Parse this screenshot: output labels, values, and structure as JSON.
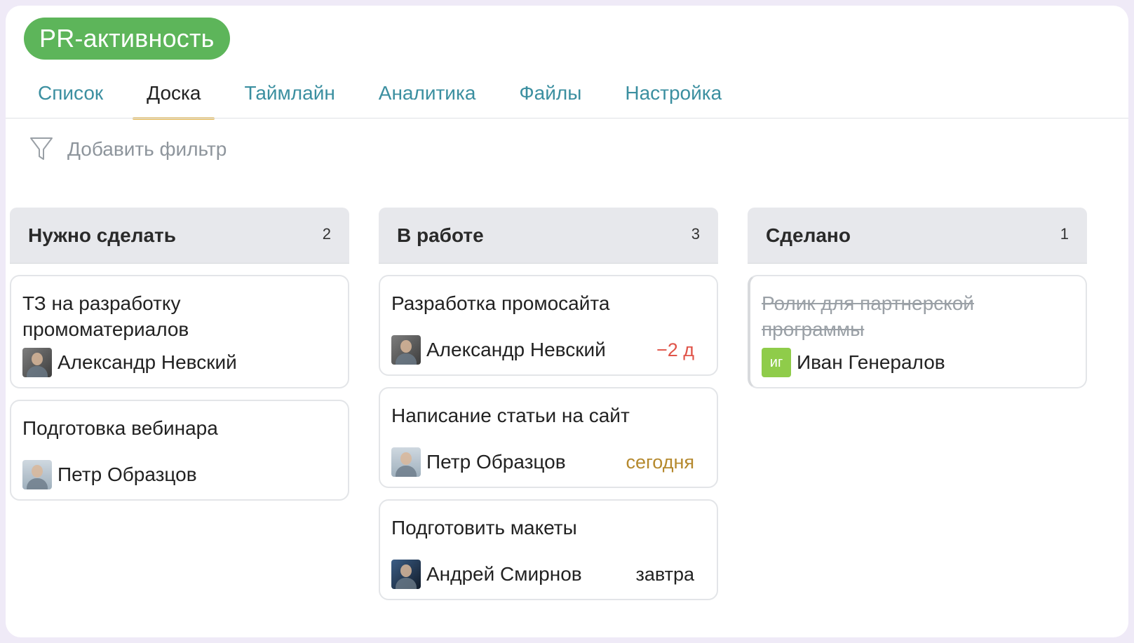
{
  "project": {
    "title": "PR-активность",
    "color": "#5db55a"
  },
  "tabs": [
    {
      "label": "Список"
    },
    {
      "label": "Доска",
      "active": true
    },
    {
      "label": "Таймлайн"
    },
    {
      "label": "Аналитика"
    },
    {
      "label": "Файлы"
    },
    {
      "label": "Настройка"
    }
  ],
  "filter": {
    "label": "Добавить фильтр",
    "icon": "filter-icon"
  },
  "columns": [
    {
      "title": "Нужно сделать",
      "count": "2",
      "cards": [
        {
          "title": "ТЗ на разработку промоматериалов",
          "assignee": "Александр Невский",
          "due": "",
          "done": false
        },
        {
          "title": "Подготовка вебинара",
          "assignee": "Петр Образцов",
          "due": "",
          "done": false
        }
      ]
    },
    {
      "title": "В работе",
      "count": "3",
      "cards": [
        {
          "title": "Разработка промосайта",
          "assignee": "Александр Невский",
          "due": "−2 д",
          "due_color": "#e0554a",
          "done": false
        },
        {
          "title": "Написание статьи на сайт",
          "assignee": "Петр Образцов",
          "due": "сегодня",
          "due_color": "#b5892e",
          "done": false
        },
        {
          "title": "Подготовить макеты",
          "assignee": "Андрей Смирнов",
          "due": "завтра",
          "due_color": "#222222",
          "done": false
        }
      ]
    },
    {
      "title": "Сделано",
      "count": "1",
      "cards": [
        {
          "title": "Ролик для партнерской программы",
          "assignee": "Иван Генералов",
          "initials": "иг",
          "due": "",
          "done": true
        }
      ]
    }
  ]
}
